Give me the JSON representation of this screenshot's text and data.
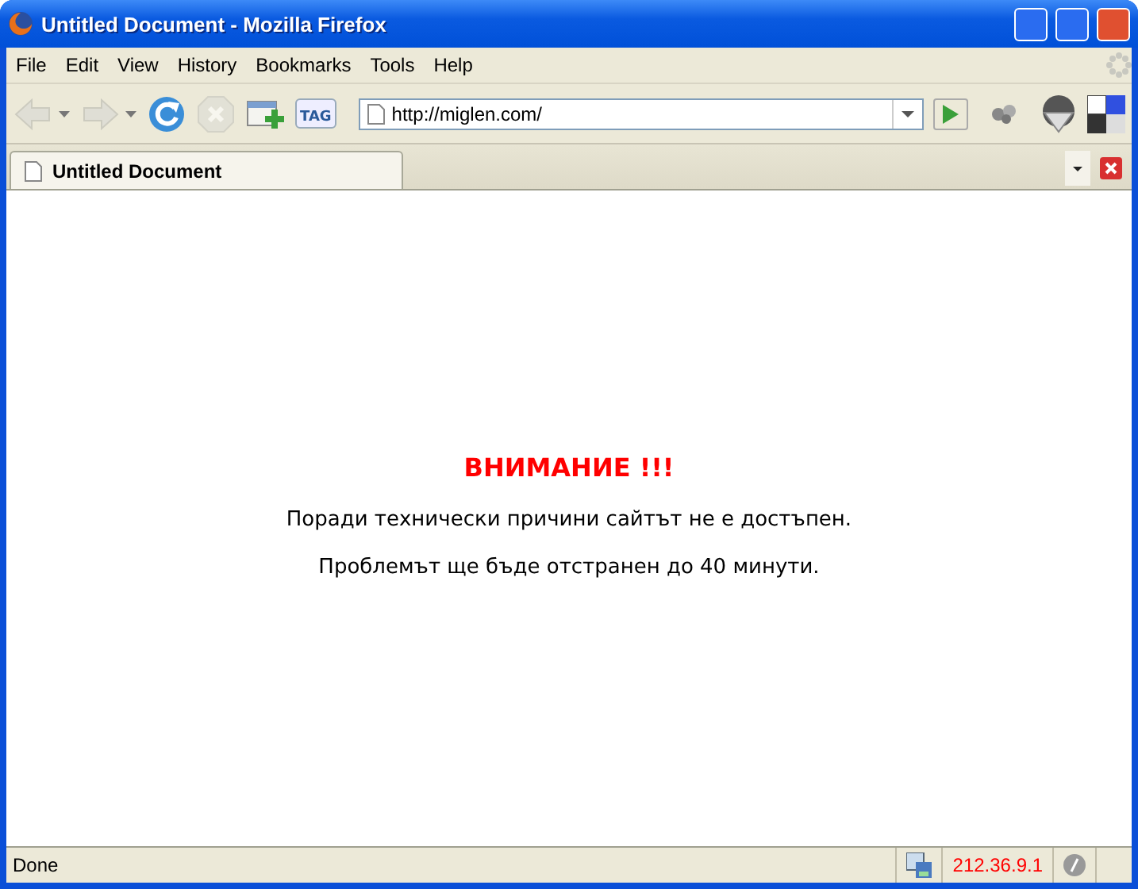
{
  "window": {
    "title": "Untitled Document - Mozilla Firefox"
  },
  "menu": [
    {
      "label": "File"
    },
    {
      "label": "Edit"
    },
    {
      "label": "View"
    },
    {
      "label": "History"
    },
    {
      "label": "Bookmarks"
    },
    {
      "label": "Tools"
    },
    {
      "label": "Help"
    }
  ],
  "toolbar": [
    {
      "kind": "back",
      "disabled": true
    },
    {
      "kind": "forward",
      "disabled": true
    },
    {
      "kind": "reload",
      "disabled": false
    },
    {
      "kind": "stop",
      "disabled": true
    },
    {
      "kind": "bookmark",
      "disabled": false
    },
    {
      "kind": "tag",
      "disabled": false,
      "label": "TAG"
    }
  ],
  "address": {
    "value": "http://miglen.com/"
  },
  "tabs": [
    {
      "label": "Untitled Document",
      "selected": true
    }
  ],
  "content": {
    "heading": "ВНИМАНИЕ !!!",
    "paragraphs": [
      "Поради технически причини сайтът не е достъпен.",
      "Проблемът ще бъде отстранен до 40 минути."
    ]
  },
  "status_bar": {
    "text": "Done",
    "ip": "212.36.9.1"
  }
}
